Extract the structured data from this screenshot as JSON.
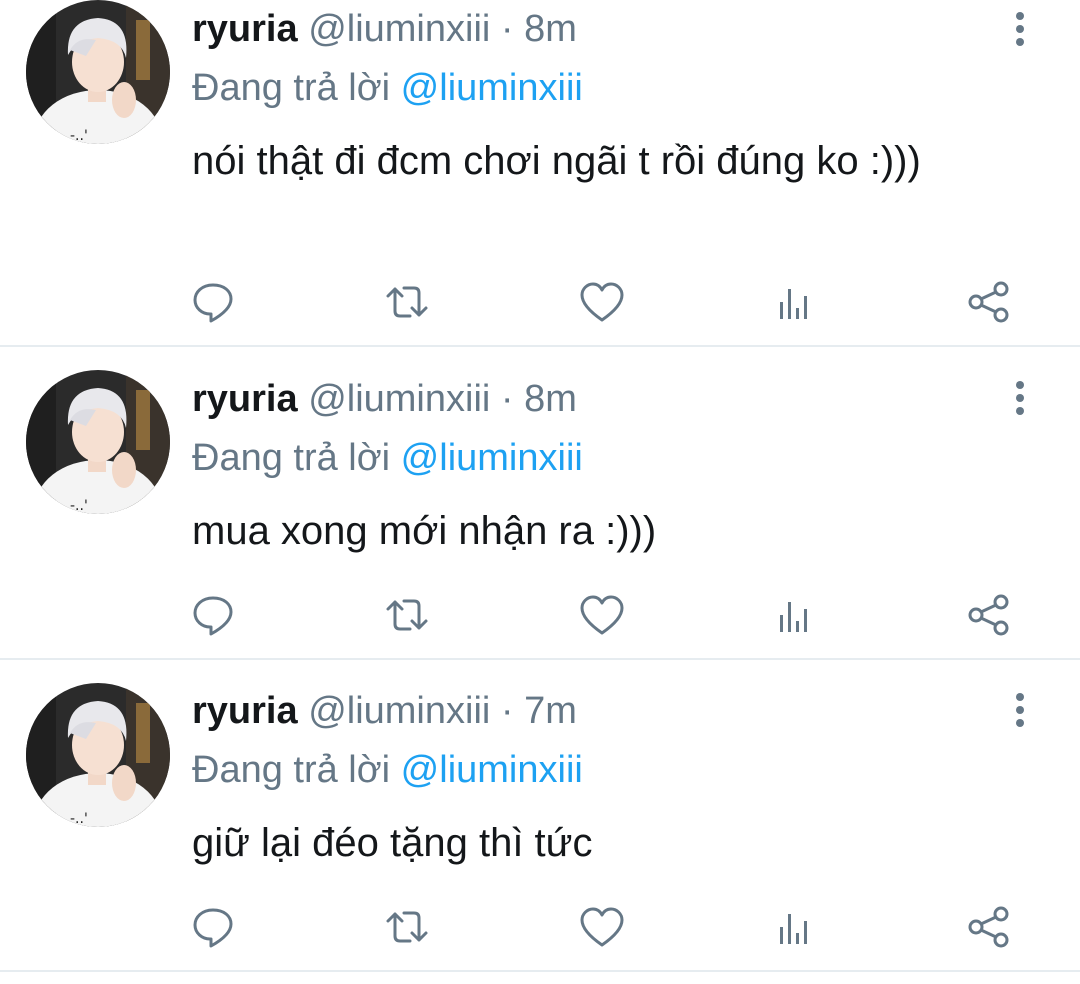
{
  "colors": {
    "text": "#14171a",
    "secondary": "#657786",
    "mention": "#1da1f2",
    "divider": "#e6ecf0",
    "icon": "#657786"
  },
  "tweets": [
    {
      "display_name": "ryuria",
      "handle": "@liuminxiii",
      "separator": "·",
      "time": "8m",
      "reply_prefix": "Đang trả lời",
      "reply_to": "@liuminxiii",
      "text": "nói thật đi đcm chơi ngãi t rồi đúng ko :)))"
    },
    {
      "display_name": "ryuria",
      "handle": "@liuminxiii",
      "separator": "·",
      "time": "8m",
      "reply_prefix": "Đang trả lời",
      "reply_to": "@liuminxiii",
      "text": "mua xong mới nhận ra :)))"
    },
    {
      "display_name": "ryuria",
      "handle": "@liuminxiii",
      "separator": "·",
      "time": "7m",
      "reply_prefix": "Đang trả lời",
      "reply_to": "@liuminxiii",
      "text": "giữ lại đéo tặng thì tức"
    }
  ],
  "action_icons": [
    "reply-icon",
    "retweet-icon",
    "like-icon",
    "analytics-icon",
    "share-icon"
  ],
  "more_icon": "more-vertical-icon",
  "avatar_icon": "profile-avatar"
}
